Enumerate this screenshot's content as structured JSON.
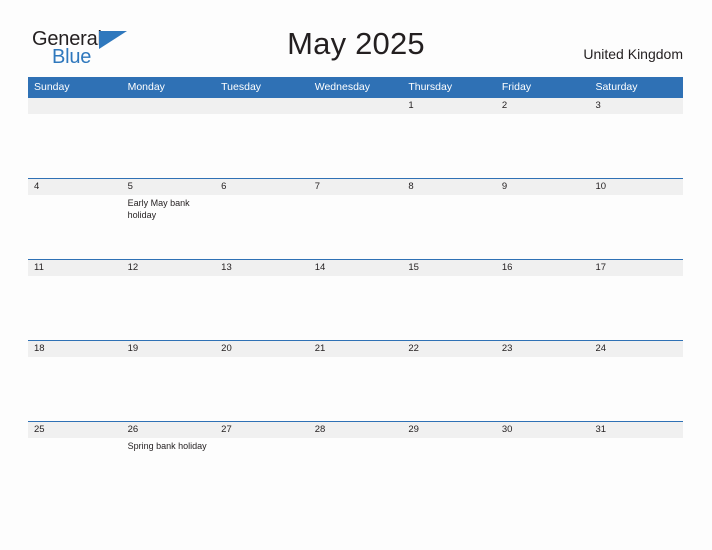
{
  "brand": {
    "word1": "General",
    "word2": "Blue",
    "color_dark": "#231f20",
    "color_blue": "#2f78bd"
  },
  "header": {
    "title": "May 2025",
    "region": "United Kingdom"
  },
  "theme": {
    "header_blue": "#2f71b5",
    "band_gray": "#f0f0f0",
    "page_bg": "#fdfdfd"
  },
  "calendar": {
    "day_headers": [
      "Sunday",
      "Monday",
      "Tuesday",
      "Wednesday",
      "Thursday",
      "Friday",
      "Saturday"
    ],
    "weeks": [
      [
        {
          "num": "",
          "event": ""
        },
        {
          "num": "",
          "event": ""
        },
        {
          "num": "",
          "event": ""
        },
        {
          "num": "",
          "event": ""
        },
        {
          "num": "1",
          "event": ""
        },
        {
          "num": "2",
          "event": ""
        },
        {
          "num": "3",
          "event": ""
        }
      ],
      [
        {
          "num": "4",
          "event": ""
        },
        {
          "num": "5",
          "event": "Early May bank holiday"
        },
        {
          "num": "6",
          "event": ""
        },
        {
          "num": "7",
          "event": ""
        },
        {
          "num": "8",
          "event": ""
        },
        {
          "num": "9",
          "event": ""
        },
        {
          "num": "10",
          "event": ""
        }
      ],
      [
        {
          "num": "11",
          "event": ""
        },
        {
          "num": "12",
          "event": ""
        },
        {
          "num": "13",
          "event": ""
        },
        {
          "num": "14",
          "event": ""
        },
        {
          "num": "15",
          "event": ""
        },
        {
          "num": "16",
          "event": ""
        },
        {
          "num": "17",
          "event": ""
        }
      ],
      [
        {
          "num": "18",
          "event": ""
        },
        {
          "num": "19",
          "event": ""
        },
        {
          "num": "20",
          "event": ""
        },
        {
          "num": "21",
          "event": ""
        },
        {
          "num": "22",
          "event": ""
        },
        {
          "num": "23",
          "event": ""
        },
        {
          "num": "24",
          "event": ""
        }
      ],
      [
        {
          "num": "25",
          "event": ""
        },
        {
          "num": "26",
          "event": "Spring bank holiday"
        },
        {
          "num": "27",
          "event": ""
        },
        {
          "num": "28",
          "event": ""
        },
        {
          "num": "29",
          "event": ""
        },
        {
          "num": "30",
          "event": ""
        },
        {
          "num": "31",
          "event": ""
        }
      ]
    ]
  }
}
